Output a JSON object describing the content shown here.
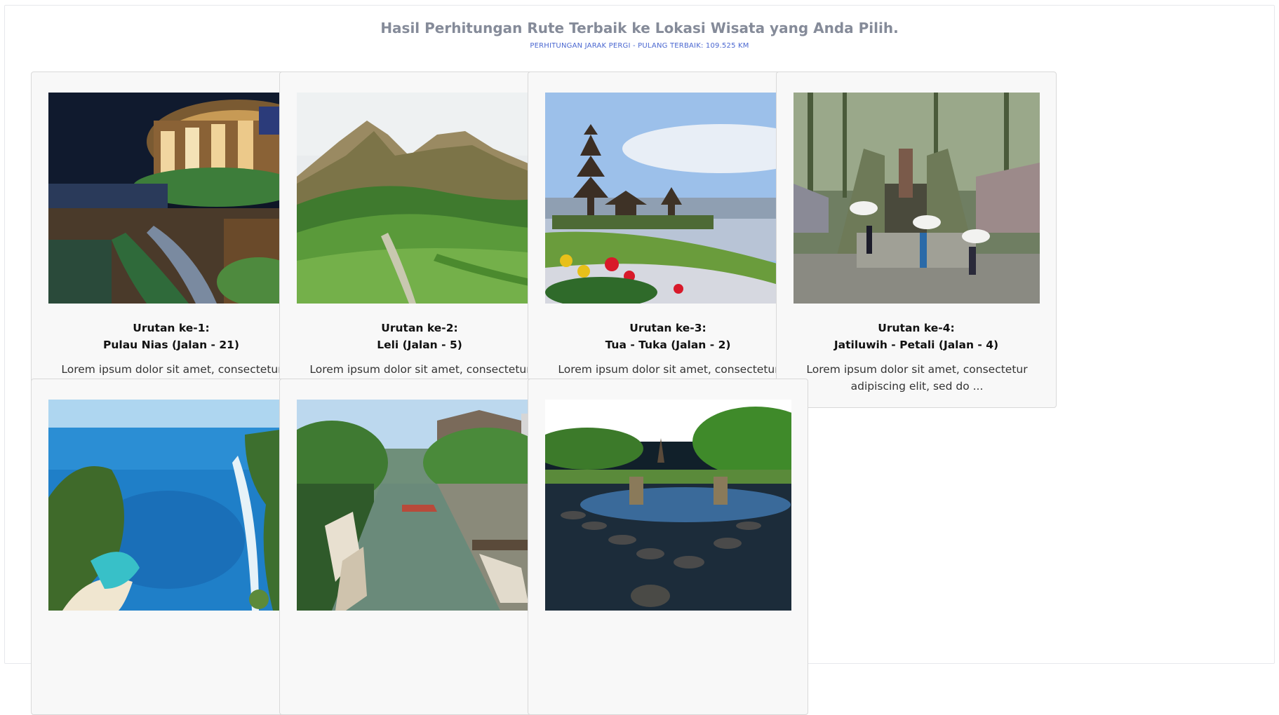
{
  "header": {
    "title": "Hasil Perhitungan Rute Terbaik ke Lokasi Wisata yang Anda Pilih.",
    "subtitle": "PERHITUNGAN JARAK PERGI - PULANG TERBAIK: 109.525 KM"
  },
  "cards": [
    {
      "order": "Urutan ke-1:",
      "name": "Pulau Nias (Jalan - 21)",
      "desc": "Lorem ipsum dolor sit amet, consectetur adipiscing elit, sed do ..."
    },
    {
      "order": "Urutan ke-2:",
      "name": "Leli (Jalan - 5)",
      "desc": "Lorem ipsum dolor sit amet, consectetur adipiscing elit, sed do ..."
    },
    {
      "order": "Urutan ke-3:",
      "name": "Tua - Tuka (Jalan - 2)",
      "desc": "Lorem ipsum dolor sit amet, consectetur adipiscing elit, sed do ..."
    },
    {
      "order": "Urutan ke-4:",
      "name": "Jatiluwih - Petali (Jalan - 4)",
      "desc": "Lorem ipsum dolor sit amet, consectetur adipiscing elit, sed do ..."
    },
    {
      "order": "",
      "name": "",
      "desc": ""
    },
    {
      "order": "",
      "name": "",
      "desc": ""
    },
    {
      "order": "",
      "name": "",
      "desc": ""
    }
  ]
}
